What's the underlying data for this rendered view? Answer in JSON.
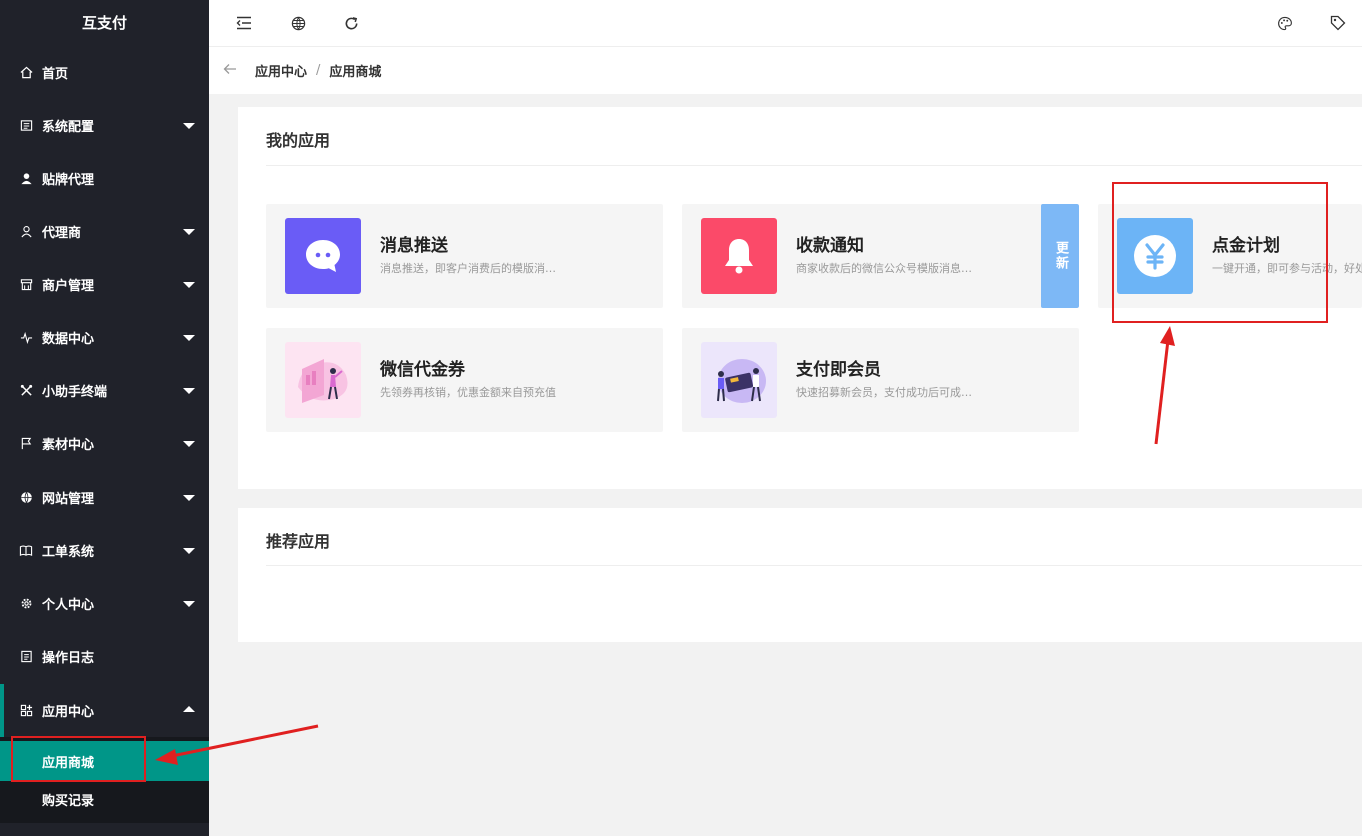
{
  "app": {
    "title": "互支付"
  },
  "sidebar": {
    "items": [
      {
        "label": "首页",
        "icon": "home-icon",
        "has_caret": false
      },
      {
        "label": "系统配置",
        "icon": "settings-icon",
        "has_caret": true
      },
      {
        "label": "贴牌代理",
        "icon": "user-icon",
        "has_caret": false
      },
      {
        "label": "代理商",
        "icon": "person-icon",
        "has_caret": true
      },
      {
        "label": "商户管理",
        "icon": "store-icon",
        "has_caret": true
      },
      {
        "label": "数据中心",
        "icon": "pulse-icon",
        "has_caret": true
      },
      {
        "label": "小助手终端",
        "icon": "tools-icon",
        "has_caret": true
      },
      {
        "label": "素材中心",
        "icon": "flag-icon",
        "has_caret": true
      },
      {
        "label": "网站管理",
        "icon": "globe-icon",
        "has_caret": true
      },
      {
        "label": "工单系统",
        "icon": "book-icon",
        "has_caret": true
      },
      {
        "label": "个人中心",
        "icon": "gear-icon",
        "has_caret": true
      },
      {
        "label": "操作日志",
        "icon": "log-icon",
        "has_caret": false
      },
      {
        "label": "应用中心",
        "icon": "apps-icon",
        "has_caret": true
      }
    ],
    "submenu": [
      {
        "label": "应用商城",
        "active": true
      },
      {
        "label": "购买记录",
        "active": false
      }
    ]
  },
  "header": {
    "icons": [
      "shrink-menu-icon",
      "globe-icon",
      "refresh-icon",
      "palette-icon",
      "tag-icon"
    ]
  },
  "breadcrumb": {
    "items": [
      "应用中心",
      "应用商城"
    ],
    "separator": "/"
  },
  "my_apps": {
    "title": "我的应用",
    "cards": [
      {
        "title": "消息推送",
        "desc": "消息推送，即客户消费后的模版消息推送",
        "color": "#6a5cf6",
        "icon": "chat-bubble-icon"
      },
      {
        "title": "收款通知",
        "desc": "商家收款后的微信公众号模版消息通知",
        "color": "#fb4a69",
        "icon": "bell-icon",
        "badge": "更新"
      },
      {
        "title": "点金计划",
        "desc": "一键开通，即可参与活动，好处多多",
        "color": "#6cb4f6",
        "icon": "yuan-icon"
      },
      {
        "title": "微信代金券",
        "desc": "先领券再核销，优惠金额来自预充值",
        "color": "#fde4f2",
        "icon": "coupon-illustration-icon"
      },
      {
        "title": "支付即会员",
        "desc": "快速招募新会员，支付成功后可成为会员",
        "color": "#ece6fb",
        "icon": "member-illustration-icon"
      }
    ]
  },
  "recommended_apps": {
    "title": "推荐应用"
  },
  "colors": {
    "sidebar_bg": "#20222a",
    "accent": "#009688",
    "highlight_red": "#e02020"
  }
}
